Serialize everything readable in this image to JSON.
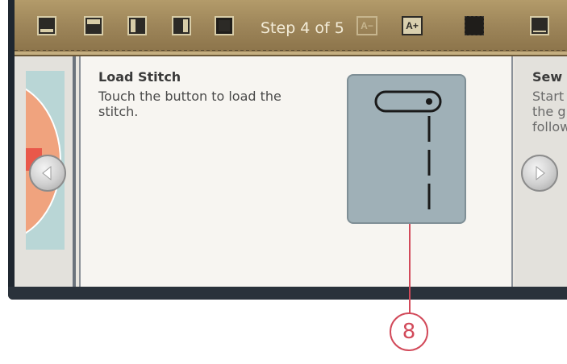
{
  "toolbar": {
    "step_text": "Step 4 of 5",
    "buttons": [
      {
        "name": "layout-bottom-half-button",
        "icon": "bottom-half-layout-icon"
      },
      {
        "name": "layout-top-half-button",
        "icon": "top-half-layout-icon"
      },
      {
        "name": "layout-left-half-button",
        "icon": "left-half-layout-icon"
      },
      {
        "name": "layout-right-half-button",
        "icon": "right-half-layout-icon"
      },
      {
        "name": "layout-full-button",
        "icon": "full-layout-icon"
      }
    ],
    "font_decrease_label": "A−",
    "font_increase_label": "A+",
    "colors": {
      "toolbar": "#a08a5e",
      "icon": "#d8cda8",
      "text": "#f3ecd8"
    }
  },
  "main": {
    "title": "Load Stitch",
    "body": "Touch the button to load the stitch."
  },
  "next_panel": {
    "title": "Sew",
    "body": "Start the g follow"
  },
  "callout": {
    "number": "8",
    "color": "#d24a5a"
  }
}
